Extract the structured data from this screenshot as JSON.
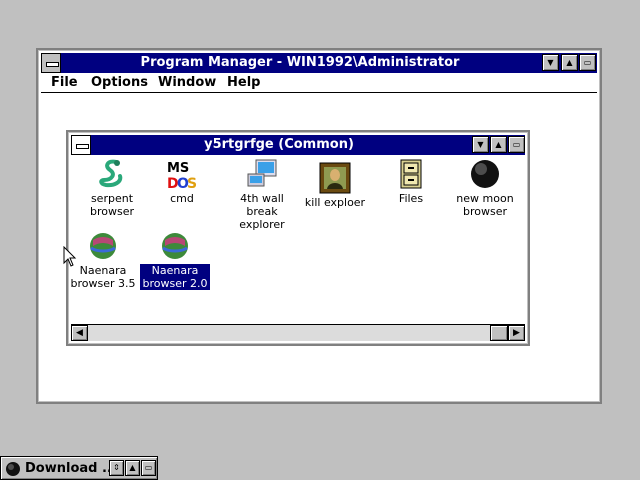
{
  "program_manager": {
    "title": "Program Manager - WIN1992\\Administrator",
    "menu": [
      "File",
      "Options",
      "Window",
      "Help"
    ]
  },
  "group": {
    "title": "y5rtgrfge (Common)",
    "icons": [
      {
        "label_line1": "serpent",
        "label_line2": "browser",
        "icon": "serpent-icon",
        "selected": false
      },
      {
        "label_line1": "cmd",
        "label_line2": "",
        "icon": "msdos-icon",
        "selected": false
      },
      {
        "label_line1": "4th wall break",
        "label_line2": "explorer",
        "icon": "computer-icon",
        "selected": false
      },
      {
        "label_line1": "kill exploer",
        "label_line2": "",
        "icon": "portrait-icon",
        "selected": false
      },
      {
        "label_line1": "Files",
        "label_line2": "",
        "icon": "file-cabinet-icon",
        "selected": false
      },
      {
        "label_line1": "new moon",
        "label_line2": "browser",
        "icon": "moon-icon",
        "selected": false
      },
      {
        "label_line1": "Naenara",
        "label_line2": "browser 3.5",
        "icon": "globe-icon",
        "selected": false
      },
      {
        "label_line1": "Naenara",
        "label_line2": "browser 2.0",
        "icon": "globe-icon",
        "selected": true
      }
    ]
  },
  "taskbar": {
    "title": "Download ..."
  },
  "colors": {
    "titlebar": "#000080",
    "desktop": "#c0c0c0",
    "selection": "#000080"
  }
}
